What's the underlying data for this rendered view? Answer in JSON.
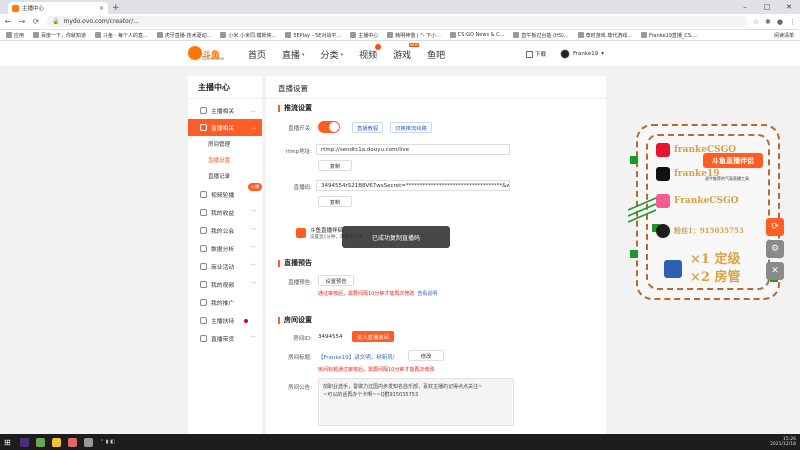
{
  "browser": {
    "tab_title": "主播中心",
    "url": "mydo.ovo.com/creator/...",
    "back": "←",
    "forward": "→",
    "reload": "⟳",
    "new_tab": "+",
    "close": "×",
    "win_min": "–",
    "win_max": "□",
    "win_close": "✕"
  },
  "bookmarks": [
    "应用",
    "百度一下，你就知道",
    "斗鱼 - 每个人的直...",
    "虎牙直播-技术驱动...",
    "小米.小米同.模新侠...",
    "5EPlay - 5E对战平...",
    "主播中心",
    "韩明神偕 ( \"- 下小...",
    "CS:GO News & C...",
    "直牛板过台能 (HS)...",
    "尊时游戏.尊代游戏...",
    "Franke19直播_CS:..."
  ],
  "bookmarks_right": "阅读清单",
  "site": {
    "logo_text": "斗鱼",
    "logo_sub": "DOUYU.COM",
    "nav": [
      "首页",
      "直播",
      "分类",
      "视频",
      "游戏",
      "鱼吧"
    ],
    "nav_new": "NEW",
    "download": "下载",
    "username": "Franke19"
  },
  "sidebar": {
    "title": "主播中心",
    "items": [
      {
        "label": "主播相关"
      },
      {
        "label": "直播相关"
      },
      {
        "label": "视频轮播"
      },
      {
        "label": "我的收益"
      },
      {
        "label": "我的公会"
      },
      {
        "label": "数据分析"
      },
      {
        "label": "商业活动"
      },
      {
        "label": "我的视频"
      },
      {
        "label": "我的推广"
      },
      {
        "label": "主播扶持"
      },
      {
        "label": "直播带货"
      }
    ],
    "subitems": [
      "房间管理",
      "直播设置",
      "直播记录"
    ],
    "badge": "火爆"
  },
  "content": {
    "title": "直播设置",
    "sec_stream": "推流设置",
    "stream_switch_label": "直播开关:",
    "btn_tutorial": "直播教程",
    "btn_scene": "切换推流线路",
    "rtmp_label": "rtmp地址:",
    "rtmp_value": "rtmp://sendtc1a.douyu.com/live",
    "copy": "复制",
    "code_label": "直播码:",
    "code_value": "3494554rS21B8V67wsSecret=***********************************&wsTir",
    "promo_title": "斗鱼直播伴侣",
    "promo_sub": "设置直1分钟，开播更方便",
    "sec_preview": "直播预告",
    "preview_label": "直播预告:",
    "btn_set_preview": "设置预告",
    "preview_warn": "通过审核后，需要间隔10分钟才能再次修改",
    "preview_link": "查看说明",
    "sec_room": "房间设置",
    "room_id_label": "房间ID:",
    "room_id": "3494554",
    "btn_enter_room": "进入直播房间",
    "room_title_label": "房间标题:",
    "room_title": "【Franke19】讲文明，树新风!",
    "btn_modify": "修改",
    "room_title_warn": "房间标题通过审核后，需要间隔10分钟才能再次修改",
    "notice_label": "房间公告:",
    "notice_line1": "前职业选手，誓做力过国内步发知名酋乐部，喜欢主播的记得点点关注~",
    "notice_line2": "~可以的话再办个卡啊~~Q群915035753"
  },
  "toast": "已成功复制直播码",
  "widget": {
    "row1": "frankeCSGO",
    "row2": "franke19",
    "row3": "FrankeCSGO",
    "row4": "粉丝1：915035753",
    "big1": "×1 定级",
    "big2": "×2 房管",
    "banner": "斗鱼直播伴侣",
    "banner_sub": "虎牛推荐的气氛直播工具",
    "colors": {
      "weibo": "#e6162d",
      "tiktok": "#111111",
      "bilibili": "#f25d8e",
      "penguin": "#1e1e1e",
      "rocket": "#2f5fb3"
    }
  },
  "taskbar": {
    "time": "15:26",
    "date": "2021/12/18"
  }
}
